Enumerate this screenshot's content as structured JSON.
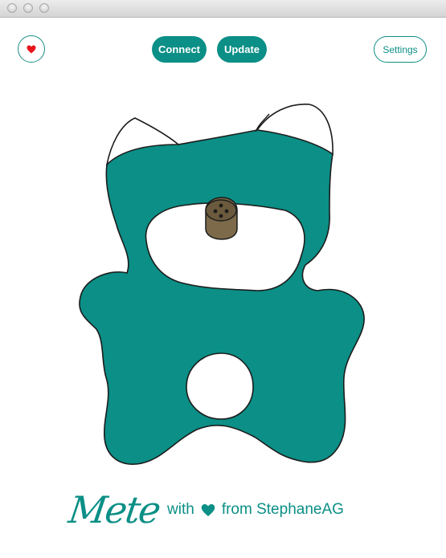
{
  "window": {
    "titlebar_buttons": [
      "close",
      "minimize",
      "zoom"
    ]
  },
  "toolbar": {
    "favorite_icon": "heart-icon",
    "favorite_color": "#e8141b",
    "connect_label": "Connect",
    "update_label": "Update",
    "settings_label": "Settings",
    "accent_color": "#0b8f86"
  },
  "bear": {
    "body_color": "#0b8f86",
    "ear_color": "#ffffff",
    "nose_color": "#7c6a4a"
  },
  "footer": {
    "logo_text": "Mete",
    "with_label": "with",
    "heart_icon": "heart-icon",
    "from_label": "from StephaneAG"
  }
}
